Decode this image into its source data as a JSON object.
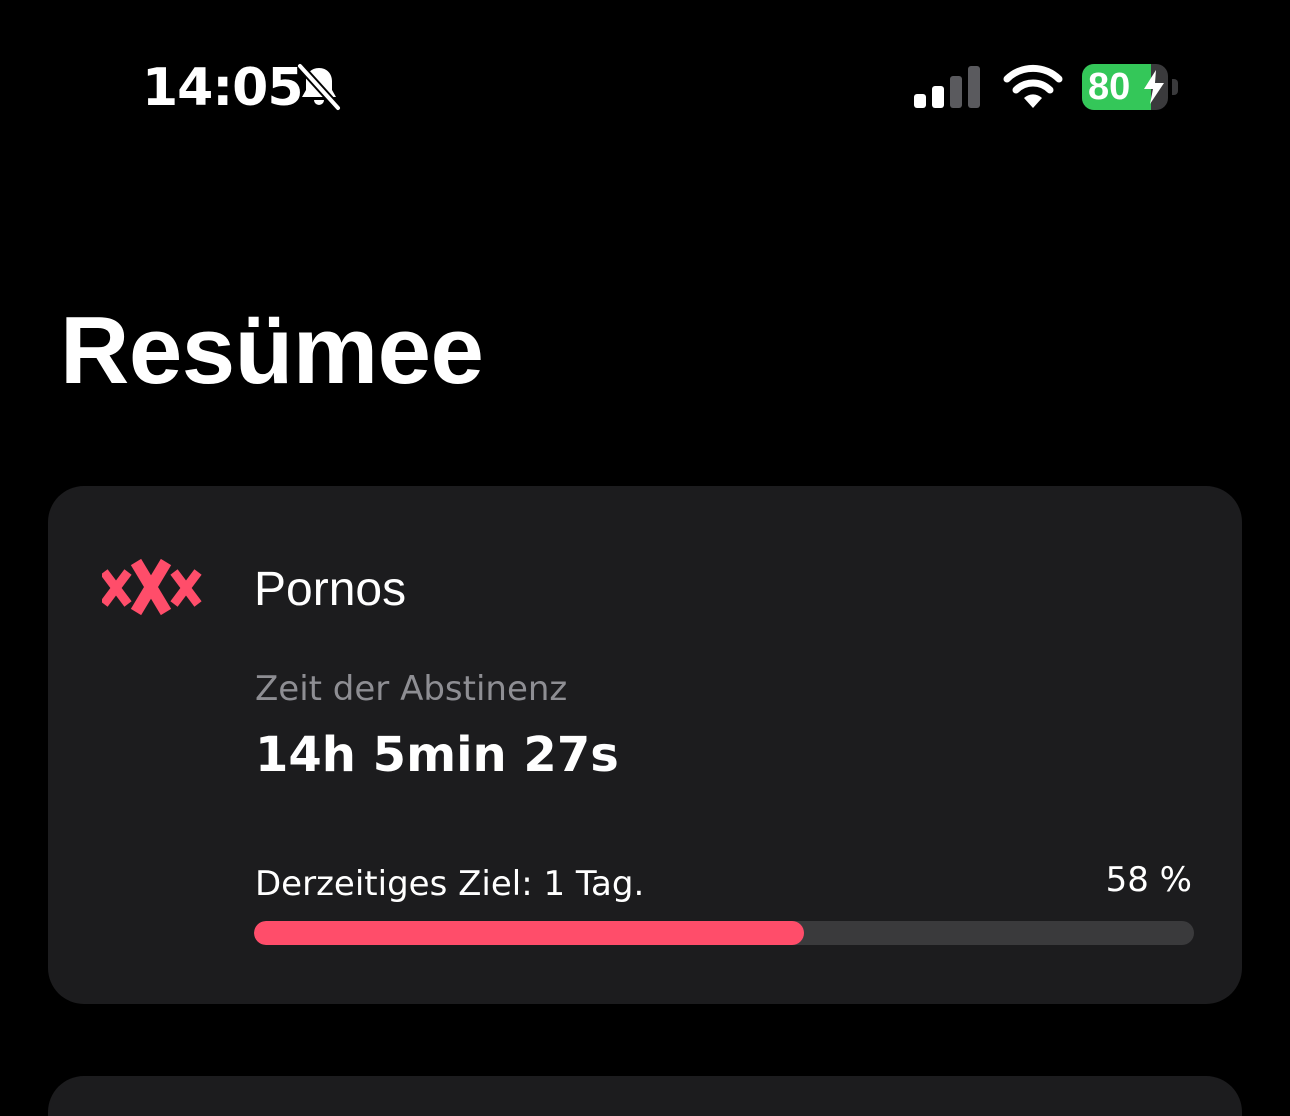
{
  "status_bar": {
    "time": "14:05",
    "silent_icon": "bell-slash-icon",
    "signal_icon": "cellular-signal-icon",
    "signal_bars_active": 2,
    "signal_bars_total": 4,
    "wifi_icon": "wifi-icon",
    "battery_label": "80",
    "battery_level": 0.8,
    "battery_charging": true,
    "battery_color": "#34c759"
  },
  "page": {
    "title": "Resümee"
  },
  "summary_card": {
    "icon": "xxx-icon",
    "icon_color": "#ff4d6a",
    "title": "Pornos",
    "abstinence_label": "Zeit der Abstinenz",
    "abstinence_value": "14h 5min 27s",
    "goal_label": "Derzeitiges Ziel: 1 Tag.",
    "goal_percent_label": "58 %",
    "progress_fraction": 0.585,
    "progress_color": "#ff4d6a"
  }
}
